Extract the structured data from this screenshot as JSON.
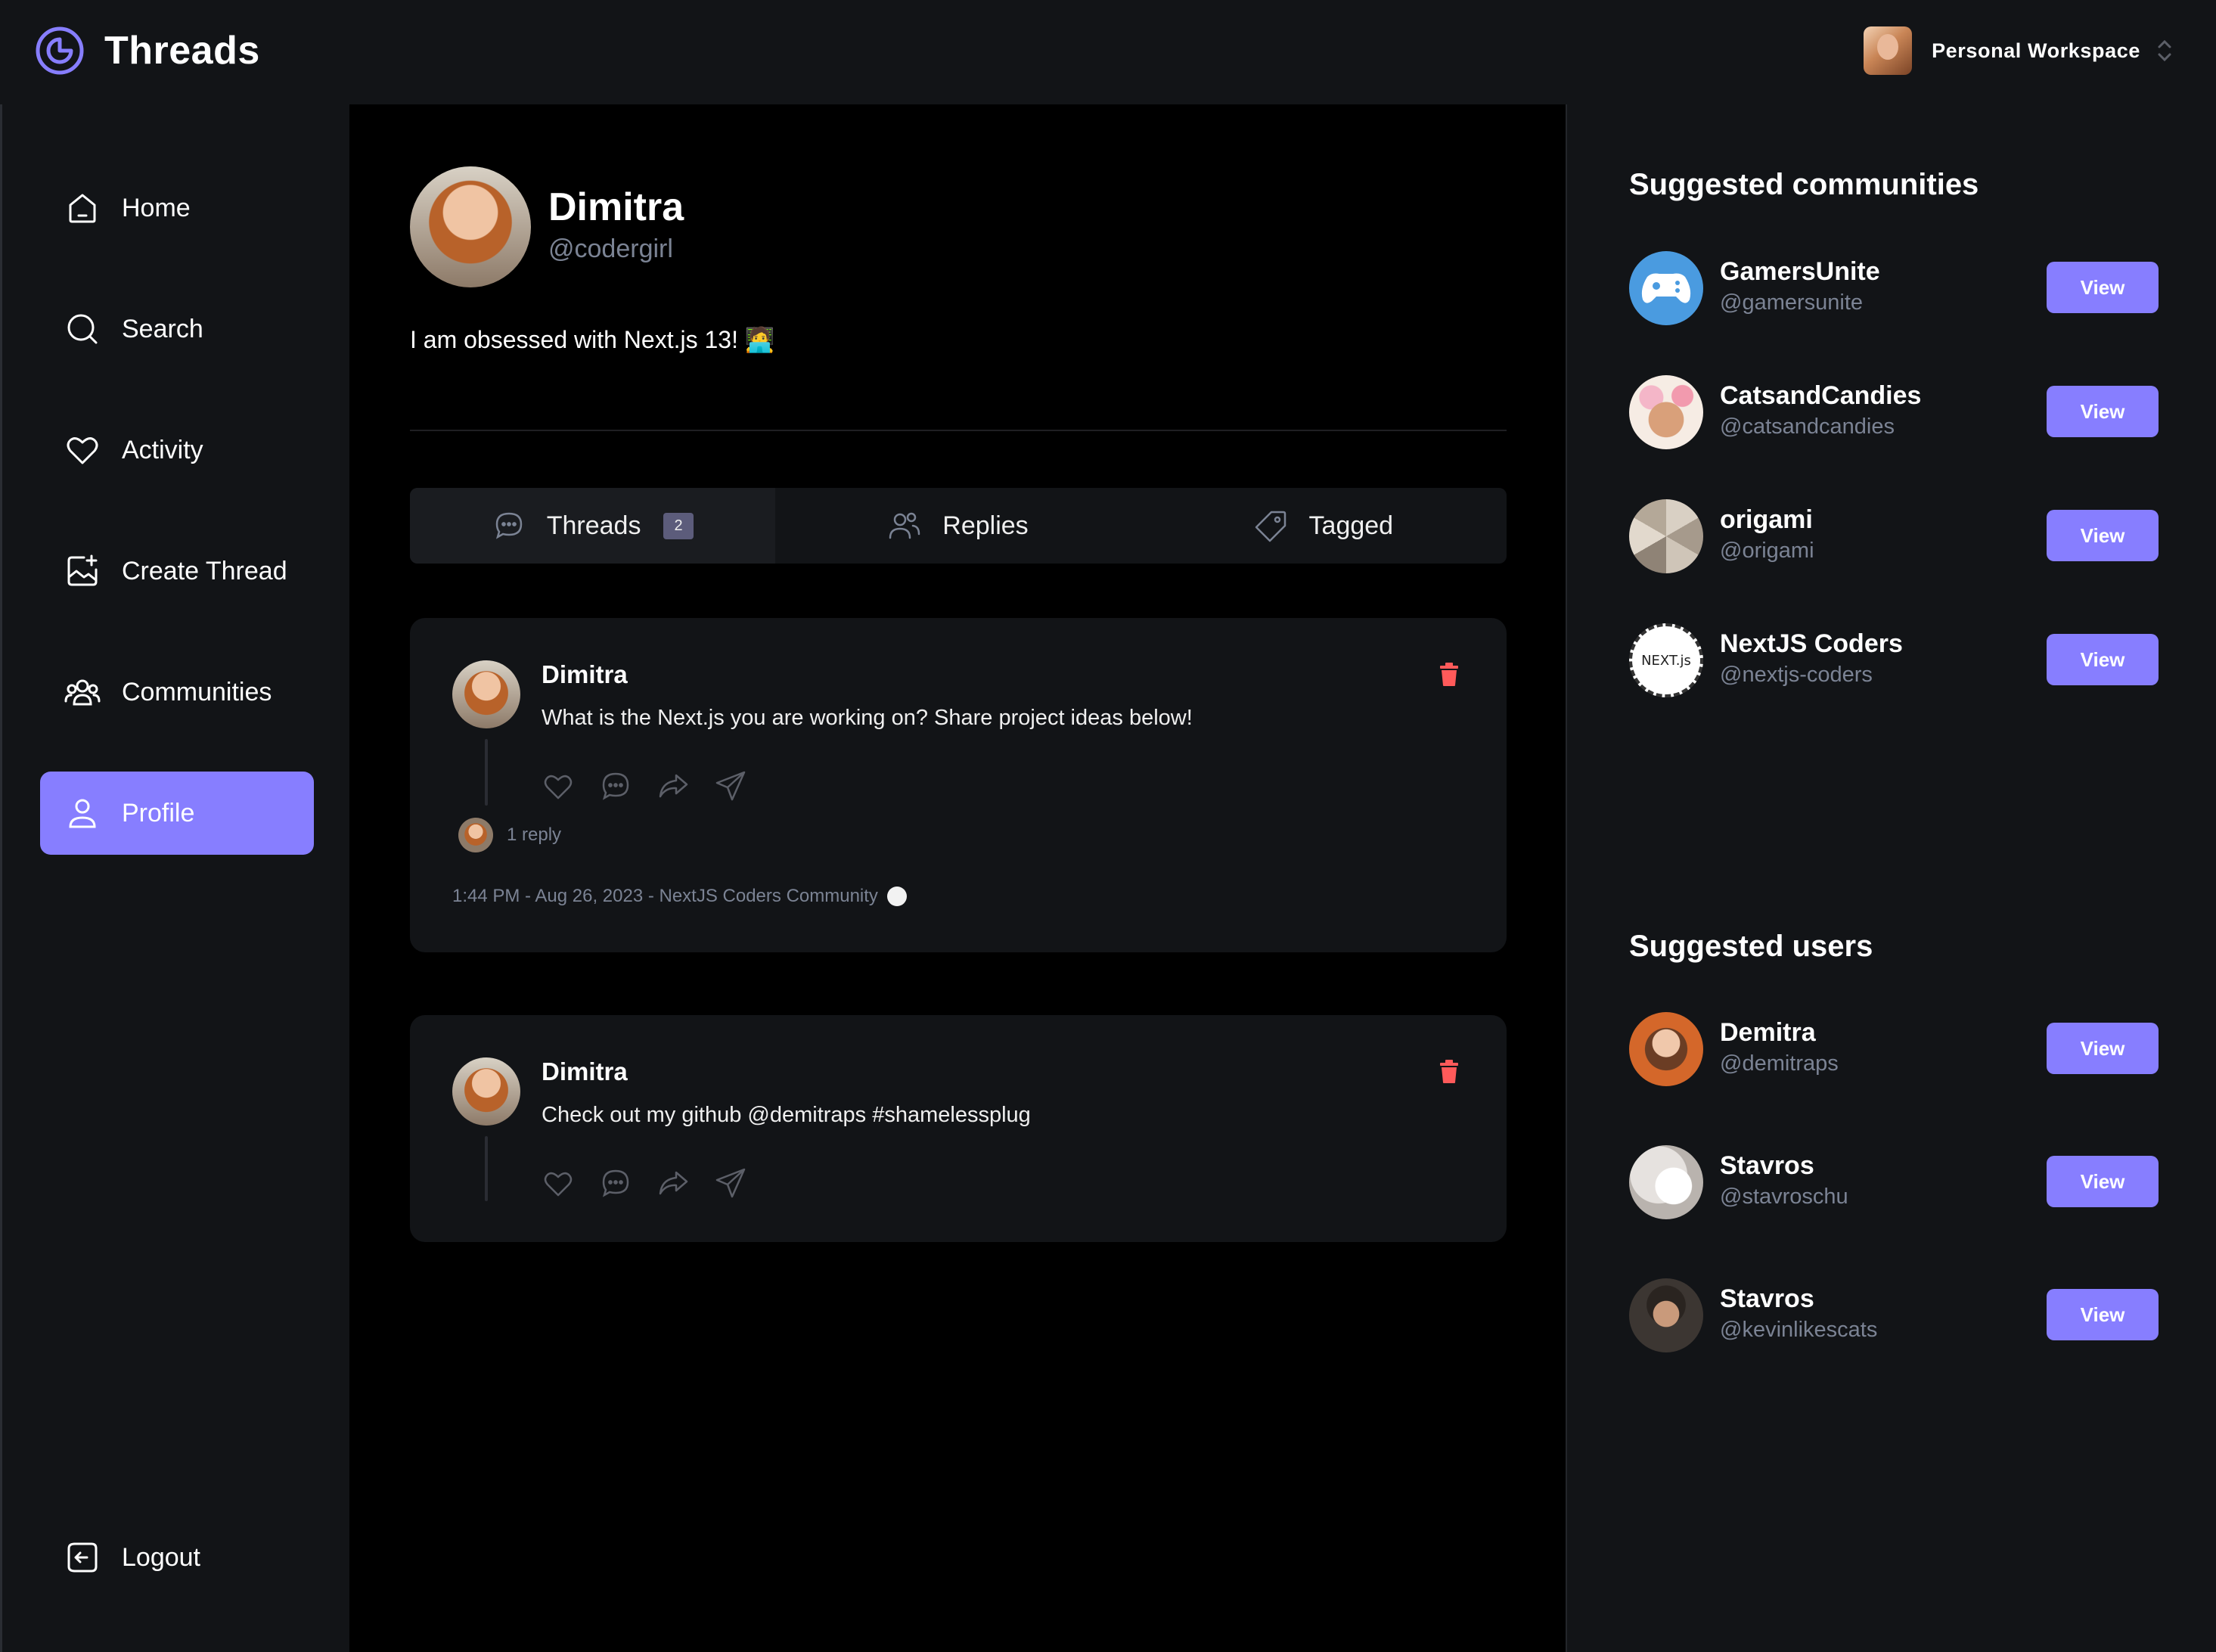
{
  "app": {
    "name": "Threads"
  },
  "workspace": {
    "label": "Personal Workspace"
  },
  "sidebar": {
    "items": [
      {
        "label": "Home",
        "icon": "home-icon"
      },
      {
        "label": "Search",
        "icon": "search-icon"
      },
      {
        "label": "Activity",
        "icon": "heart-icon"
      },
      {
        "label": "Create Thread",
        "icon": "create-thread-icon"
      },
      {
        "label": "Communities",
        "icon": "communities-icon"
      },
      {
        "label": "Profile",
        "icon": "user-icon",
        "active": true
      }
    ],
    "logout": "Logout"
  },
  "profile": {
    "name": "Dimitra",
    "handle": "@codergirl",
    "bio": "I am obsessed with Next.js 13! 🧑‍💻"
  },
  "tabs": [
    {
      "label": "Threads",
      "badge": "2",
      "icon": "chat-bubble-icon"
    },
    {
      "label": "Replies",
      "icon": "members-icon"
    },
    {
      "label": "Tagged",
      "icon": "tag-icon"
    }
  ],
  "threads": [
    {
      "author": "Dimitra",
      "text": "What is the Next.js you are working on? Share project ideas below!",
      "reply_count": "1 reply",
      "meta": "1:44 PM - Aug 26, 2023 - NextJS Coders Community"
    },
    {
      "author": "Dimitra",
      "text": "Check out my github @demitraps #shamelessplug"
    }
  ],
  "suggested_communities": {
    "title": "Suggested communities",
    "items": [
      {
        "name": "GamersUnite",
        "handle": "@gamersunite",
        "button": "View"
      },
      {
        "name": "CatsandCandies",
        "handle": "@catsandcandies",
        "button": "View"
      },
      {
        "name": "origami",
        "handle": "@origami",
        "button": "View"
      },
      {
        "name": "NextJS Coders",
        "handle": "@nextjs-coders",
        "button": "View",
        "avatar_text": "NEXT.js"
      }
    ]
  },
  "suggested_users": {
    "title": "Suggested users",
    "items": [
      {
        "name": "Demitra",
        "handle": "@demitraps",
        "button": "View"
      },
      {
        "name": "Stavros",
        "handle": "@stavroschu",
        "button": "View"
      },
      {
        "name": "Stavros",
        "handle": "@kevinlikescats",
        "button": "View"
      }
    ]
  },
  "colors": {
    "accent": "#877eff",
    "delete": "#ff5a5a",
    "background": "#121417",
    "main": "#000000",
    "muted": "#7b8394"
  }
}
